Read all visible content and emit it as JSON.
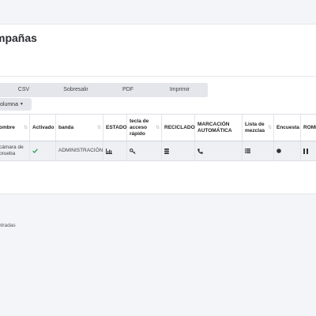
{
  "page": {
    "title": "mpañas"
  },
  "export_buttons": [
    {
      "label": "CSV"
    },
    {
      "label": "Sobresalir"
    },
    {
      "label": "PDF"
    },
    {
      "label": "Imprimir"
    }
  ],
  "column_button": {
    "label": "olumna"
  },
  "table": {
    "headers": [
      {
        "label": "ombre"
      },
      {
        "label": "Activado"
      },
      {
        "label": "banda"
      },
      {
        "label": "ESTADO"
      },
      {
        "label": "tecla de acceso rápido"
      },
      {
        "label": "RECICLADO"
      },
      {
        "label": "MARCACIÓN AUTOMÁTICA"
      },
      {
        "label": "Lista de mezclas"
      },
      {
        "label": "Encuesta"
      },
      {
        "label": "ROMP"
      }
    ],
    "row": {
      "name": "cámara de prueba",
      "activated_icon": "check-icon",
      "band": "ADMINISTRACIÓN",
      "status_icon": "bar-chart-icon",
      "hotkey_icon": "key-icon",
      "recycle_icon": "database-icon",
      "autodial_icon": "phone-icon",
      "mixlist_icon": "list-icon",
      "survey_icon": "circle-icon",
      "romp_icon": "pause-icon"
    }
  },
  "info": {
    "text": "ntradas"
  },
  "colors": {
    "check": "#3aa35b",
    "icon": "#333333",
    "accent": "#e4e6ec"
  }
}
